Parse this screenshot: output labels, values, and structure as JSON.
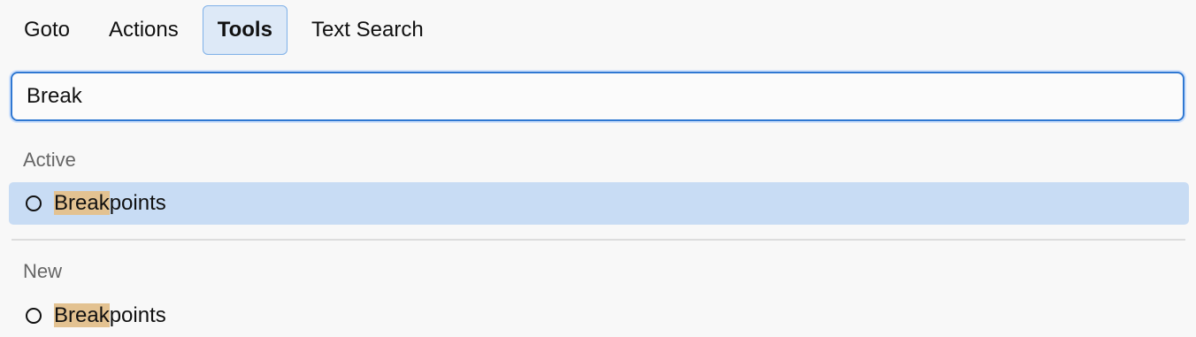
{
  "tabs": [
    {
      "label": "Goto",
      "active": false
    },
    {
      "label": "Actions",
      "active": false
    },
    {
      "label": "Tools",
      "active": true
    },
    {
      "label": "Text Search",
      "active": false
    }
  ],
  "search": {
    "value": "Break"
  },
  "sections": {
    "active": {
      "label": "Active",
      "items": [
        {
          "match": "Break",
          "rest": "points",
          "icon": "circle-outline-icon",
          "selected": true
        }
      ]
    },
    "new": {
      "label": "New",
      "items": [
        {
          "match": "Break",
          "rest": "points",
          "icon": "circle-outline-icon",
          "selected": false
        }
      ]
    }
  },
  "colors": {
    "accent": "#2f78d2",
    "selection": "#c8dcf4",
    "match_highlight": "#e3c291"
  }
}
